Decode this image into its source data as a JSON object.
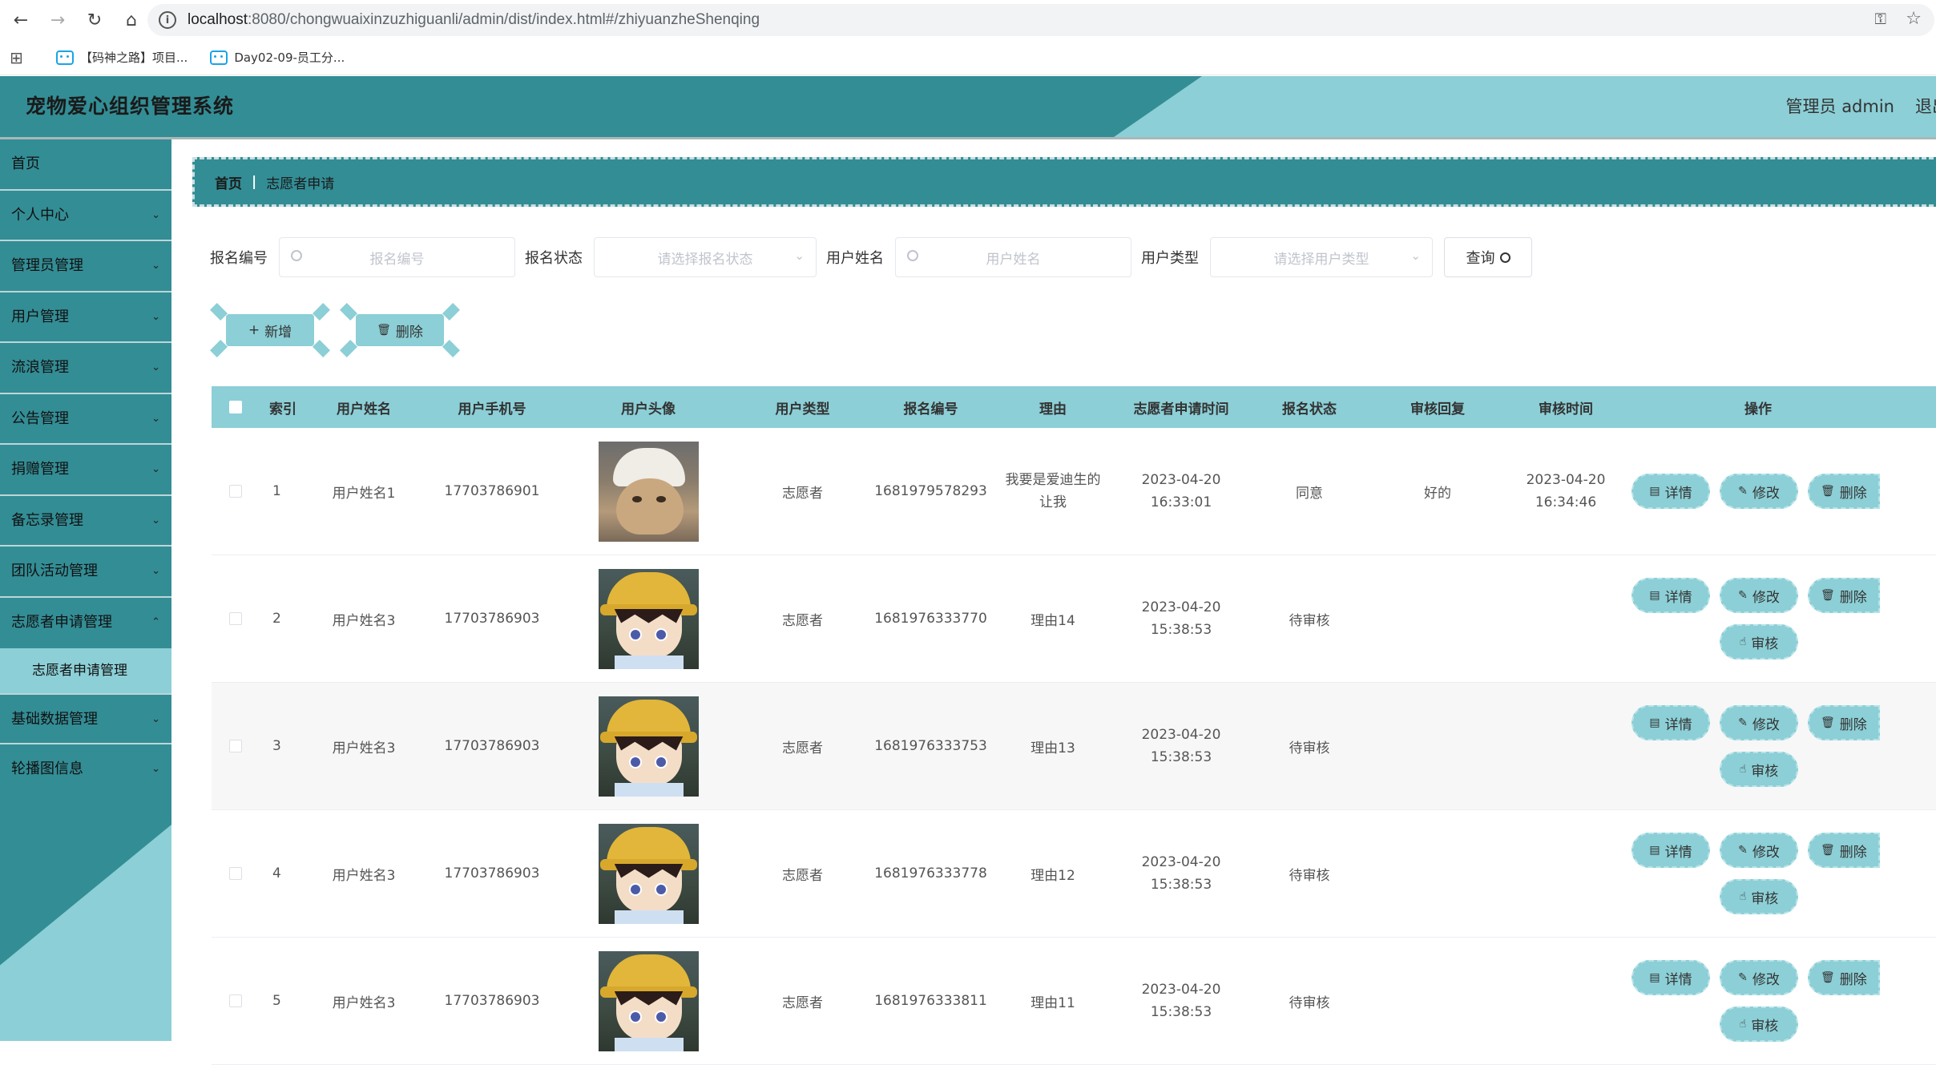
{
  "browser": {
    "url_host": "localhost",
    "url_rest": ":8080/chongwuaixinzuzhiguanli/admin/dist/index.html#/zhiyuanzheShenqing",
    "bookmarks": [
      "【码神之路】项目...",
      "Day02-09-员工分..."
    ]
  },
  "header": {
    "title": "宠物爱心组织管理系统",
    "user": "管理员 admin",
    "logout": "退出"
  },
  "sidebar": {
    "items": [
      {
        "label": "首页",
        "expandable": false
      },
      {
        "label": "个人中心",
        "expandable": true
      },
      {
        "label": "管理员管理",
        "expandable": true
      },
      {
        "label": "用户管理",
        "expandable": true
      },
      {
        "label": "流浪管理",
        "expandable": true
      },
      {
        "label": "公告管理",
        "expandable": true
      },
      {
        "label": "捐赠管理",
        "expandable": true
      },
      {
        "label": "备忘录管理",
        "expandable": true
      },
      {
        "label": "团队活动管理",
        "expandable": true
      },
      {
        "label": "志愿者申请管理",
        "expandable": true
      }
    ],
    "active_sub": "志愿者申请管理",
    "items_after": [
      {
        "label": "基础数据管理"
      },
      {
        "label": "轮播图信息"
      }
    ]
  },
  "breadcrumb": {
    "home": "首页",
    "separator": "|",
    "current": "志愿者申请"
  },
  "filters": {
    "signup_no": {
      "label": "报名编号",
      "placeholder": "报名编号"
    },
    "status": {
      "label": "报名状态",
      "placeholder": "请选择报名状态"
    },
    "user_name": {
      "label": "用户姓名",
      "placeholder": "用户姓名"
    },
    "user_type": {
      "label": "用户类型",
      "placeholder": "请选择用户类型"
    },
    "query_label": "查询"
  },
  "actions": {
    "add": "新增",
    "delete": "删除"
  },
  "table": {
    "headers": [
      "索引",
      "用户姓名",
      "用户手机号",
      "用户头像",
      "用户类型",
      "报名编号",
      "理由",
      "志愿者申请时间",
      "报名状态",
      "审核回复",
      "审核时间",
      "操作"
    ],
    "op_labels": {
      "detail": "详情",
      "edit": "修改",
      "delete": "删除",
      "audit": "审核"
    },
    "rows": [
      {
        "index": "1",
        "name": "用户姓名1",
        "phone": "17703786901",
        "avatar": "cat",
        "type": "志愿者",
        "no": "1681979578293",
        "reason": "我要是爱迪生的让我",
        "apply_time": "2023-04-20 16:33:01",
        "status": "同意",
        "reply": "好的",
        "audit_time": "2023-04-20 16:34:46",
        "can_audit": false
      },
      {
        "index": "2",
        "name": "用户姓名3",
        "phone": "17703786903",
        "avatar": "boy",
        "type": "志愿者",
        "no": "1681976333770",
        "reason": "理由14",
        "apply_time": "2023-04-20 15:38:53",
        "status": "待审核",
        "reply": "",
        "audit_time": "",
        "can_audit": true
      },
      {
        "index": "3",
        "name": "用户姓名3",
        "phone": "17703786903",
        "avatar": "boy",
        "type": "志愿者",
        "no": "1681976333753",
        "reason": "理由13",
        "apply_time": "2023-04-20 15:38:53",
        "status": "待审核",
        "reply": "",
        "audit_time": "",
        "can_audit": true
      },
      {
        "index": "4",
        "name": "用户姓名3",
        "phone": "17703786903",
        "avatar": "boy",
        "type": "志愿者",
        "no": "1681976333778",
        "reason": "理由12",
        "apply_time": "2023-04-20 15:38:53",
        "status": "待审核",
        "reply": "",
        "audit_time": "",
        "can_audit": true
      },
      {
        "index": "5",
        "name": "用户姓名3",
        "phone": "17703786903",
        "avatar": "boy",
        "type": "志愿者",
        "no": "1681976333811",
        "reason": "理由11",
        "apply_time": "2023-04-20 15:38:53",
        "status": "待审核",
        "reply": "",
        "audit_time": "",
        "can_audit": true
      }
    ]
  },
  "colors": {
    "primary": "#338d95",
    "accent": "#8ccfd6"
  }
}
